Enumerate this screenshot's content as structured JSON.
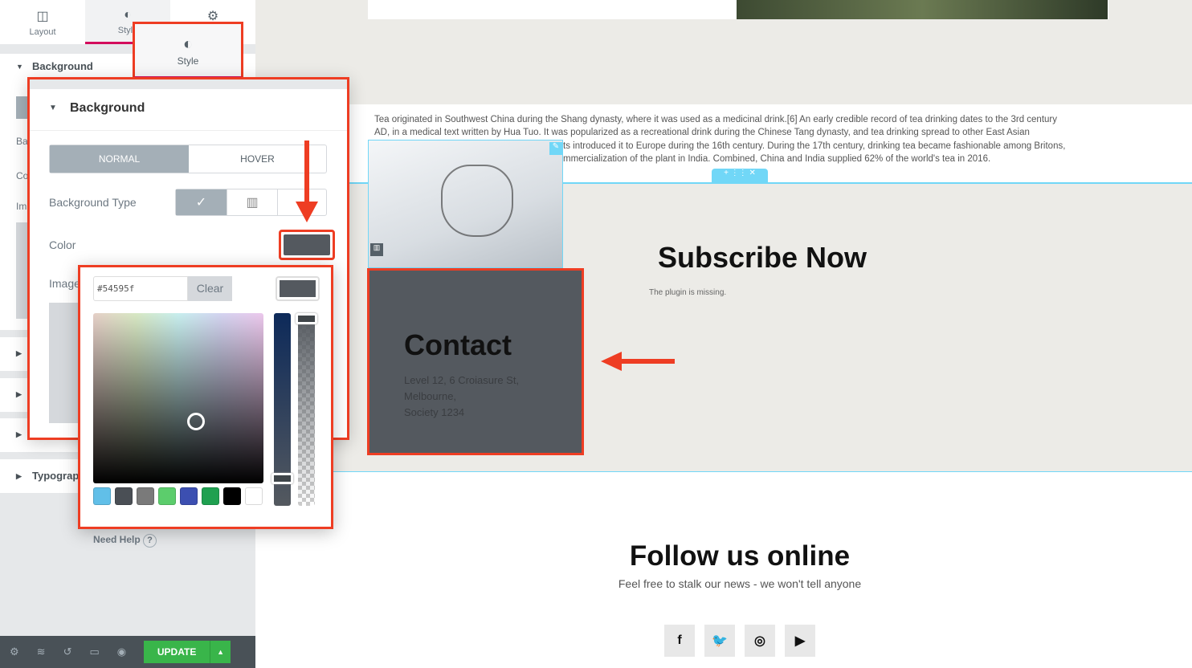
{
  "panel": {
    "tabs": [
      {
        "label": "Layout",
        "icon": "layout-icon"
      },
      {
        "label": "Style",
        "icon": "contrast-icon"
      },
      {
        "label": "",
        "icon": "gear-icon"
      }
    ],
    "section_background": "Background",
    "bg_side_labels": [
      "Ba",
      "Co",
      "Im"
    ],
    "typography": "Typograp",
    "need_help": "Need Help"
  },
  "callout_style_tab": {
    "label": "Style"
  },
  "bg_popup": {
    "title": "Background",
    "state_tabs": [
      "NORMAL",
      "HOVER"
    ],
    "background_type_label": "Background Type",
    "color_label": "Color",
    "image_label": "Image",
    "color_value": "#54595f"
  },
  "picker": {
    "hex_value": "#54595f",
    "clear_label": "Clear",
    "swatches": [
      "#61bfe8",
      "#4a4f55",
      "#7a7a7a",
      "#5ccd6c",
      "#3c4fb1",
      "#1fa050",
      "#000000",
      "#ffffff"
    ]
  },
  "footer": {
    "update_label": "UPDATE"
  },
  "canvas": {
    "paragraph_lines": [
      "Tea originated in Southwest China during the Shang dynasty, where it was used as a medicinal drink.[6] An early credible record of tea drinking dates to the 3rd century",
      "AD, in a medical text written by Hua Tuo. It was popularized as a recreational drink during the Chinese Tang dynasty, and tea drinking spread to other East Asian",
      "ts introduced it to Europe during the 16th century. During the 17th century, drinking tea became fashionable among Britons,",
      "mmercialization of the plant in India. Combined, China and India supplied 62% of the world's tea in 2016."
    ],
    "subscribe_title": "Subscribe Now",
    "plugin_missing": "The plugin is missing.",
    "contact_title": "Contact",
    "contact_lines": [
      "Level 12, 6 Croiasure St,",
      "Melbourne,",
      "Society 1234"
    ],
    "follow_title": "Follow us online",
    "follow_subtitle": "Feel free to stalk our news - we won't tell anyone",
    "social": [
      {
        "icon": "facebook-icon",
        "glyph": "f"
      },
      {
        "icon": "twitter-icon",
        "glyph": "🐦"
      },
      {
        "icon": "instagram-icon",
        "glyph": "◎"
      },
      {
        "icon": "youtube-icon",
        "glyph": "▶"
      }
    ]
  },
  "colors": {
    "accent": "#d30c5c",
    "highlight": "#ee3d23",
    "selected": "#54595f",
    "update": "#39b54a",
    "editor_blue": "#71d7f7"
  }
}
